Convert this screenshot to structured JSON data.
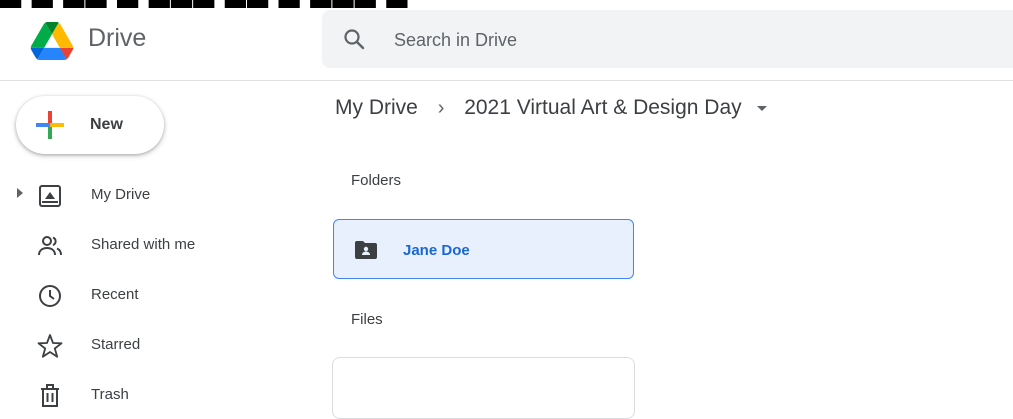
{
  "app": {
    "name": "Drive"
  },
  "search": {
    "placeholder": "Search in Drive"
  },
  "new_button": {
    "label": "New"
  },
  "sidebar": {
    "items": [
      {
        "label": "My Drive",
        "icon": "my-drive-icon"
      },
      {
        "label": "Shared with me",
        "icon": "shared-icon"
      },
      {
        "label": "Recent",
        "icon": "clock-icon"
      },
      {
        "label": "Starred",
        "icon": "star-icon"
      },
      {
        "label": "Trash",
        "icon": "trash-icon"
      }
    ]
  },
  "breadcrumb": {
    "root": "My Drive",
    "current": "2021 Virtual Art & Design Day"
  },
  "sections": {
    "folders": "Folders",
    "files": "Files"
  },
  "folders": [
    {
      "name": "Jane Doe",
      "icon": "shared-folder-icon"
    }
  ],
  "colors": {
    "accent": "#1967d2",
    "selected_bg": "#e8f0fe",
    "selected_border": "#4285f4"
  }
}
